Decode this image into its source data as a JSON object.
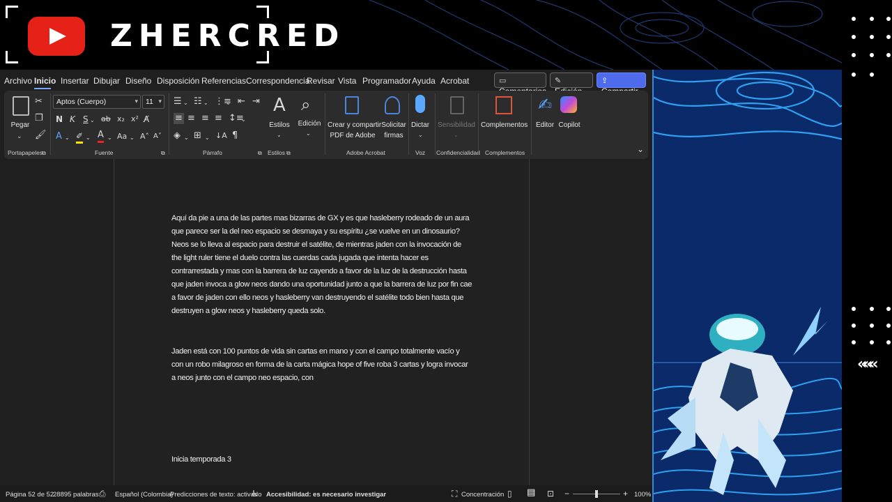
{
  "overlay": {
    "brand": "ZHERCRED",
    "rail_arrows": "«««"
  },
  "menubar": {
    "items": [
      "Archivo",
      "Inicio",
      "Insertar",
      "Dibujar",
      "Diseño",
      "Disposición",
      "Referencias",
      "Correspondencia",
      "Revisar",
      "Vista",
      "Programador",
      "Ayuda",
      "Acrobat"
    ],
    "active": "Inicio",
    "comments": "Comentarios",
    "editing": "Edición",
    "share": "Compartir"
  },
  "ribbon": {
    "paste": "Pegar",
    "font_name": "Aptos (Cuerpo)",
    "font_size": "11",
    "bold": "N",
    "italic": "K",
    "underline": "S",
    "strike": "ab",
    "styles": "Estilos",
    "editing": "Edición",
    "create_pdf": "Crear y compartir",
    "create_pdf_2": "PDF de Adobe",
    "request_sign": "Solicitar",
    "request_sign_2": "firmas",
    "dictate": "Dictar",
    "sensitivity": "Sensibilidad",
    "addins": "Complementos",
    "editor": "Editor",
    "copilot": "Copilot",
    "groups": {
      "clipboard": "Portapapeles",
      "font": "Fuente",
      "paragraph": "Párrafo",
      "styles": "Estilos",
      "adobe": "Adobe Acrobat",
      "voice": "Voz",
      "confidentiality": "Confidencialidad",
      "addins": "Complementos"
    }
  },
  "document": {
    "paragraphs": [
      "Aquí da pie a una de las partes mas bizarras de GX y es que hasleberry rodeado de un aura que parece ser la del neo espacio se desmaya y su espíritu ¿se vuelve en un dinosaurio? Neos se lo lleva al espacio para destruir el satélite, de mientras jaden con la invocación de the light ruler tiene el duelo contra las cuerdas cada jugada que intenta hacer es contrarrestada y mas con la barrera de luz cayendo a favor de la luz de la destrucción hasta que jaden invoca a glow neos dando una oportunidad junto a que la barrera de luz por fin cae a favor de jaden con ello neos y hasleberry van destruyendo el satélite todo bien hasta que destruyen a glow neos y hasleberry queda solo.",
      "Jaden está con 100 puntos de vida sin cartas en mano y con el campo totalmente vacío y con un robo milagroso en forma de la carta mágica hope of five roba 3 cartas y logra invocar a neos junto con el campo neo espacio, con",
      "Inicia temporada 3"
    ]
  },
  "status": {
    "page": "Página 52 de 52",
    "words": "28895 palabras",
    "language": "Español (Colombia)",
    "predictions": "Predicciones de texto: activado",
    "accessibility": "Accesibilidad: es necesario investigar",
    "focus": "Concentración",
    "zoom": "100%",
    "zoom_level": 1.0
  }
}
